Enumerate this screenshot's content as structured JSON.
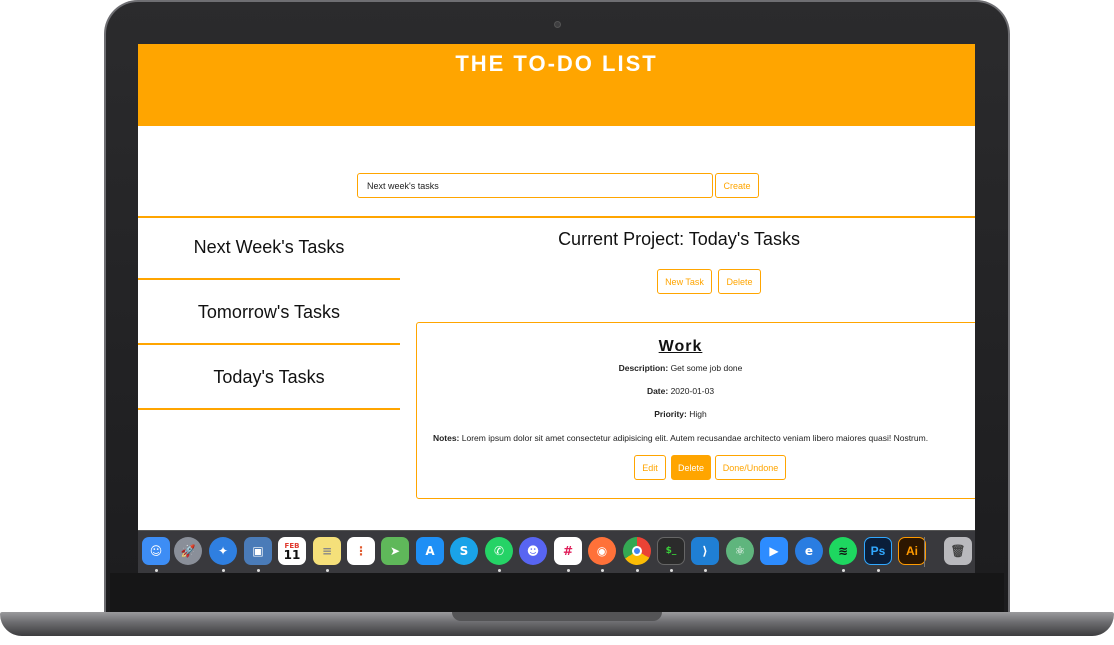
{
  "app": {
    "title": "THE TO-DO LIST"
  },
  "project_form": {
    "input_value": "Next week's tasks",
    "create_label": "Create"
  },
  "sidebar": {
    "items": [
      {
        "label": "Next Week's Tasks"
      },
      {
        "label": "Tomorrow's Tasks"
      },
      {
        "label": "Today's Tasks"
      }
    ]
  },
  "main": {
    "current_project_title": "Current Project: Today's Tasks",
    "new_task_label": "New Task",
    "delete_label": "Delete"
  },
  "task": {
    "title": "Work",
    "description_label": "Description:",
    "description": "Get some job done",
    "date_label": "Date:",
    "date": "2020-01-03",
    "priority_label": "Priority:",
    "priority": "High",
    "notes_label": "Notes:",
    "notes": "Lorem ipsum dolor sit amet consectetur adipisicing elit. Autem recusandae architecto veniam libero maiores quasi! Nostrum.",
    "edit_label": "Edit",
    "delete_label": "Delete",
    "done_label": "Done/Undone"
  },
  "dock": {
    "calendar_month": "FEB",
    "calendar_day": "11",
    "apps": [
      {
        "name": "finder-icon",
        "color": "#3d8df5"
      },
      {
        "name": "launchpad-icon",
        "color": "#8a8f99"
      },
      {
        "name": "safari-icon",
        "color": "#2f7fe0"
      },
      {
        "name": "preview-icon",
        "color": "#4a7bb8"
      },
      {
        "name": "calendar-icon",
        "color": "#ffffff"
      },
      {
        "name": "notes-icon",
        "color": "#f5e07a"
      },
      {
        "name": "reminders-icon",
        "color": "#ffffff"
      },
      {
        "name": "maps-icon",
        "color": "#5fb85a"
      },
      {
        "name": "app-store-icon",
        "color": "#1e8ff5"
      },
      {
        "name": "skype-icon",
        "color": "#1aa3e8"
      },
      {
        "name": "whatsapp-icon",
        "color": "#25d366"
      },
      {
        "name": "discord-icon",
        "color": "#5865f2"
      },
      {
        "name": "slack-icon",
        "color": "#ffffff"
      },
      {
        "name": "firefox-icon",
        "color": "#ff7139"
      },
      {
        "name": "chrome-icon",
        "color": "#ffffff"
      },
      {
        "name": "terminal-icon",
        "color": "#2b2b2b"
      },
      {
        "name": "vscode-icon",
        "color": "#1f7fd4"
      },
      {
        "name": "atom-icon",
        "color": "#5fb57d"
      },
      {
        "name": "zoom-icon",
        "color": "#2d8cff"
      },
      {
        "name": "edge-icon",
        "color": "#2a7de1"
      },
      {
        "name": "spotify-icon",
        "color": "#1ed760"
      },
      {
        "name": "photoshop-icon",
        "color": "#0a1e3a"
      },
      {
        "name": "illustrator-icon",
        "color": "#2c1600"
      },
      {
        "name": "trash-icon",
        "color": "#b9b9bd"
      }
    ]
  }
}
